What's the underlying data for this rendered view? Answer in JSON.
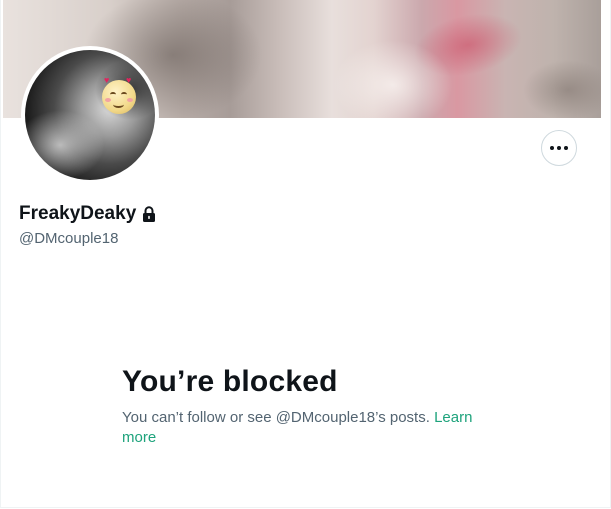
{
  "profile": {
    "display_name": "FreakyDeaky",
    "handle": "@DMcouple18",
    "protected_icon": "lock-icon",
    "avatar_emoji_icon": "smiling-face-with-hearts-icon",
    "more_icon": "more-horizontal-icon"
  },
  "blocked": {
    "title": "You’re blocked",
    "message": "You can’t follow or see @DMcouple18’s posts. ",
    "link_label": "Learn more"
  },
  "colors": {
    "primary_text": "#0f1419",
    "secondary_text": "#536471",
    "link": "#1ea37c",
    "border": "#cfd9de"
  }
}
